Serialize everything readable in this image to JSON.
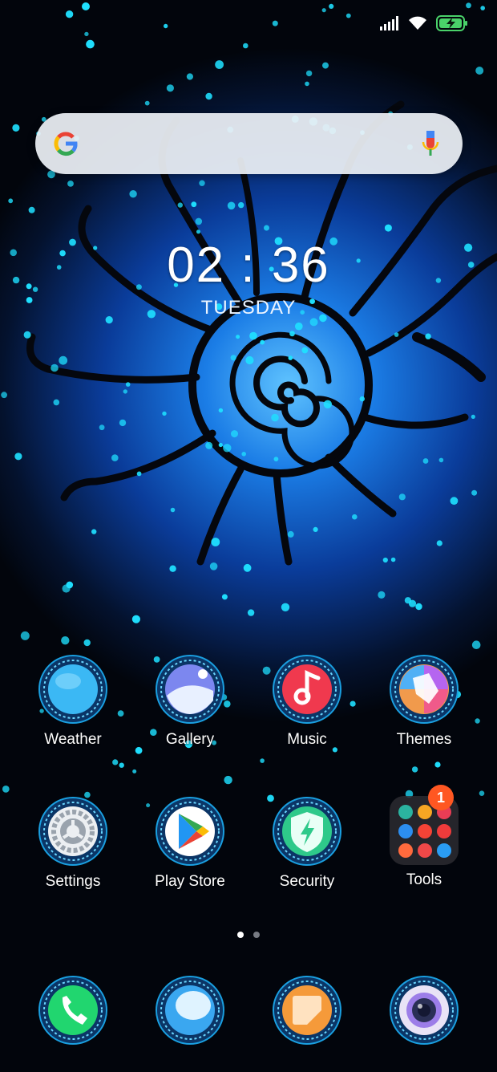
{
  "status": {
    "signal_icon": "cellular-signal-icon",
    "wifi_icon": "wifi-icon",
    "battery_icon": "battery-charging-icon"
  },
  "search": {
    "logo": "google-g-icon",
    "mic": "microphone-icon"
  },
  "clock": {
    "time": "02 : 36",
    "day": "TUESDAY"
  },
  "apps": [
    {
      "label": "Weather",
      "icon": "weather-icon"
    },
    {
      "label": "Gallery",
      "icon": "gallery-icon"
    },
    {
      "label": "Music",
      "icon": "music-icon"
    },
    {
      "label": "Themes",
      "icon": "themes-icon"
    },
    {
      "label": "Settings",
      "icon": "settings-icon"
    },
    {
      "label": "Play Store",
      "icon": "play-store-icon"
    },
    {
      "label": "Security",
      "icon": "security-icon"
    },
    {
      "label": "Tools",
      "icon": "folder-icon",
      "badge": "1"
    }
  ],
  "pages": {
    "count": 2,
    "active": 0
  },
  "dock": [
    {
      "icon": "phone-icon"
    },
    {
      "icon": "messages-icon"
    },
    {
      "icon": "notes-icon"
    },
    {
      "icon": "camera-icon"
    }
  ],
  "colors": {
    "accent": "#19d8ff",
    "badge": "#ff5722",
    "battery": "#4ad26a"
  }
}
